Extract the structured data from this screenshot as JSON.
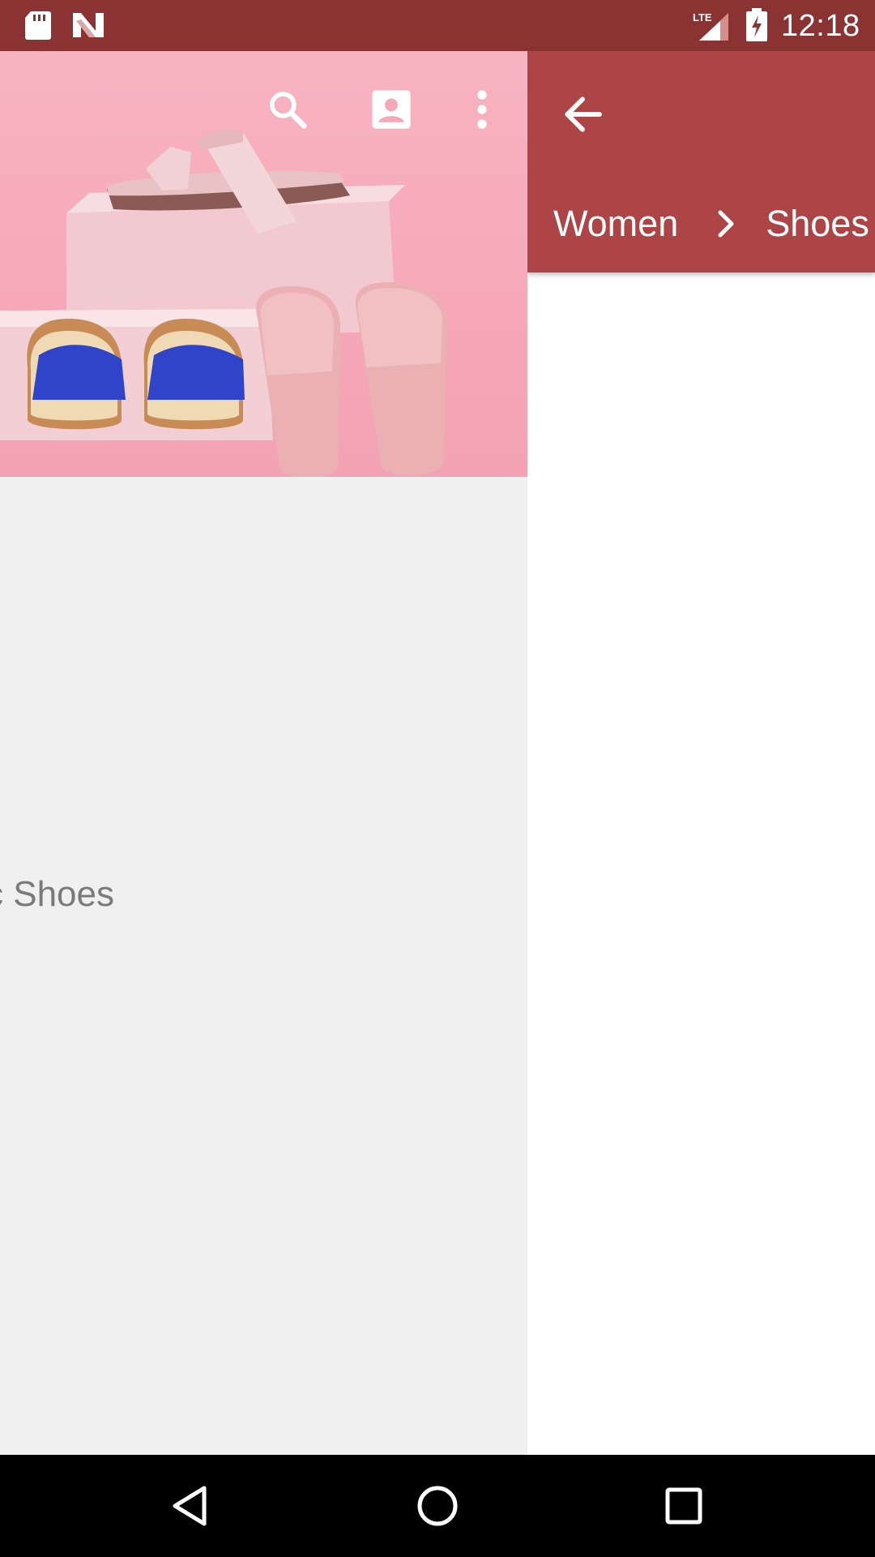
{
  "status_bar": {
    "time": "12:18",
    "network_label": "LTE",
    "icons": [
      "sd-card-icon",
      "n-notification-icon",
      "lte-signal-icon",
      "battery-charging-icon"
    ],
    "background_color": "#8b3333"
  },
  "left_page": {
    "hero_toolbar_icons": [
      "search-icon",
      "account-icon",
      "overflow-menu-icon"
    ],
    "category_label": "c Shoes"
  },
  "right_panel": {
    "header_color": "#ad4446",
    "back_icon": "arrow-back-icon",
    "breadcrumb": {
      "items": [
        "Women",
        "Shoes"
      ],
      "separator_icon": "chevron-right-icon"
    }
  },
  "nav_bar": {
    "buttons": [
      "back-triangle-icon",
      "home-circle-icon",
      "recents-square-icon"
    ]
  }
}
